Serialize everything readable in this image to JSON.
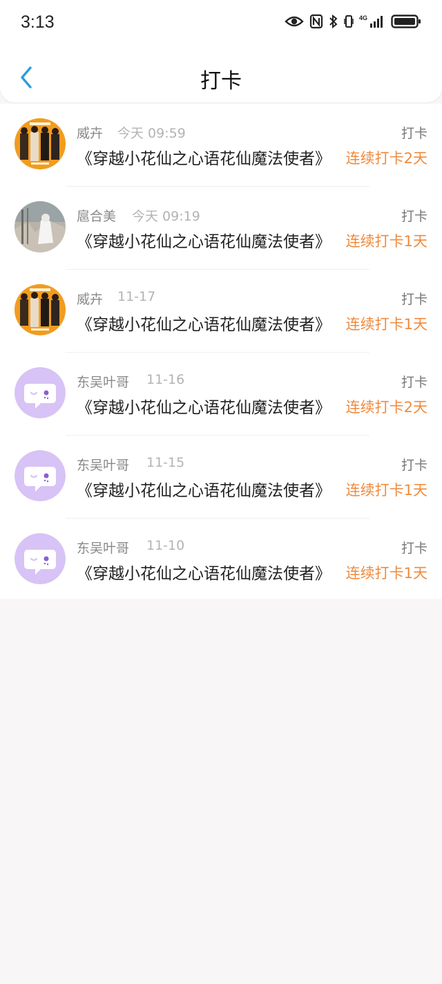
{
  "status_bar": {
    "time": "3:13",
    "icons": [
      "eye-icon",
      "nfc-icon",
      "bluetooth-icon",
      "vibrate-icon",
      "4g-signal-icon",
      "battery-icon"
    ]
  },
  "header": {
    "back_icon": "chevron-left-icon",
    "title": "打卡"
  },
  "colors": {
    "accent_blue": "#2d9cdb",
    "streak_orange": "#f08a3c",
    "avatar_purple": "#d7c3f5"
  },
  "entries": [
    {
      "name": "威卉",
      "time": "今天 09:59",
      "action": "打卡",
      "book": "《穿越小花仙之心语花仙魔法使者》",
      "streak": "连续打卡2天",
      "avatar": "photo-avatar"
    },
    {
      "name": "扈合美",
      "time": "今天 09:19",
      "action": "打卡",
      "book": "《穿越小花仙之心语花仙魔法使者》",
      "streak": "连续打卡1天",
      "avatar": "photo-avatar"
    },
    {
      "name": "威卉",
      "time": "11-17",
      "action": "打卡",
      "book": "《穿越小花仙之心语花仙魔法使者》",
      "streak": "连续打卡1天",
      "avatar": "photo-avatar"
    },
    {
      "name": "东吴叶哥",
      "time": "11-16",
      "action": "打卡",
      "book": "《穿越小花仙之心语花仙魔法使者》",
      "streak": "连续打卡2天",
      "avatar": "default-chat-avatar"
    },
    {
      "name": "东吴叶哥",
      "time": "11-15",
      "action": "打卡",
      "book": "《穿越小花仙之心语花仙魔法使者》",
      "streak": "连续打卡1天",
      "avatar": "default-chat-avatar"
    },
    {
      "name": "东吴叶哥",
      "time": "11-10",
      "action": "打卡",
      "book": "《穿越小花仙之心语花仙魔法使者》",
      "streak": "连续打卡1天",
      "avatar": "default-chat-avatar"
    }
  ]
}
